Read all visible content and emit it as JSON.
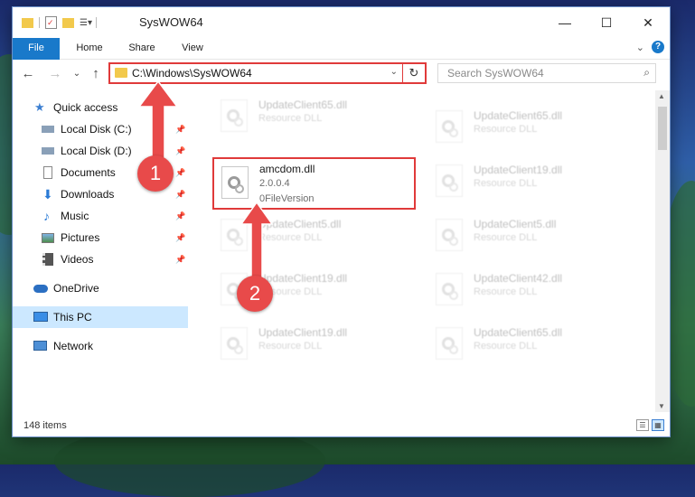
{
  "titlebar": {
    "title": "SysWOW64",
    "minimize": "—",
    "maximize": "☐",
    "close": "✕"
  },
  "ribbon": {
    "tabs": [
      "File",
      "Home",
      "Share",
      "View"
    ],
    "expand": "⌄",
    "help": "?"
  },
  "nav": {
    "back": "←",
    "forward": "→",
    "recent": "⌄",
    "up": "↑",
    "address": "C:\\Windows\\SysWOW64",
    "address_dropdown": "⌄",
    "refresh": "↻",
    "search_placeholder": "Search SysWOW64",
    "search_icon": "⌕"
  },
  "sidebar": {
    "items": [
      {
        "label": "Quick access",
        "icon": "star-icon",
        "pinned": false
      },
      {
        "label": "Local Disk (C:)",
        "icon": "drive-icon",
        "pinned": true
      },
      {
        "label": "Local Disk (D:)",
        "icon": "drive-icon",
        "pinned": true
      },
      {
        "label": "Documents",
        "icon": "documents-icon",
        "pinned": true
      },
      {
        "label": "Downloads",
        "icon": "downloads-icon",
        "pinned": true
      },
      {
        "label": "Music",
        "icon": "music-icon",
        "pinned": true
      },
      {
        "label": "Pictures",
        "icon": "pictures-icon",
        "pinned": true
      },
      {
        "label": "Videos",
        "icon": "videos-icon",
        "pinned": true
      },
      {
        "label": "OneDrive",
        "icon": "cloud-icon",
        "pinned": false
      },
      {
        "label": "This PC",
        "icon": "pc-icon",
        "pinned": false,
        "selected": true
      },
      {
        "label": "Network",
        "icon": "network-icon",
        "pinned": false
      }
    ],
    "pin_glyph": "📌"
  },
  "files": {
    "col1": [
      {
        "name": "UpdateClient65.dll",
        "type": "Resource DLL"
      },
      {
        "name": "amcdom.dll",
        "version": "2.0.0.4",
        "type": "0FileVersion",
        "highlighted": true
      },
      {
        "name": "UpdateClient5.dll",
        "type": "Resource DLL"
      },
      {
        "name": "UpdateClient19.dll",
        "type": "Resource DLL"
      },
      {
        "name": "UpdateClient19.dll",
        "type": "Resource DLL"
      }
    ],
    "col2": [
      {
        "name": "UpdateClient65.dll",
        "type": "Resource DLL"
      },
      {
        "name": "UpdateClient19.dll",
        "type": "Resource DLL"
      },
      {
        "name": "UpdateClient5.dll",
        "type": "Resource DLL"
      },
      {
        "name": "UpdateClient42.dll",
        "type": "Resource DLL"
      },
      {
        "name": "UpdateClient65.dll",
        "type": "Resource DLL"
      }
    ]
  },
  "status": {
    "count": "148 items"
  },
  "annotations": {
    "step1": "1",
    "step2": "2"
  },
  "colors": {
    "accent": "#1979ca",
    "highlight": "#e03a3a",
    "selected": "#cce8ff"
  }
}
